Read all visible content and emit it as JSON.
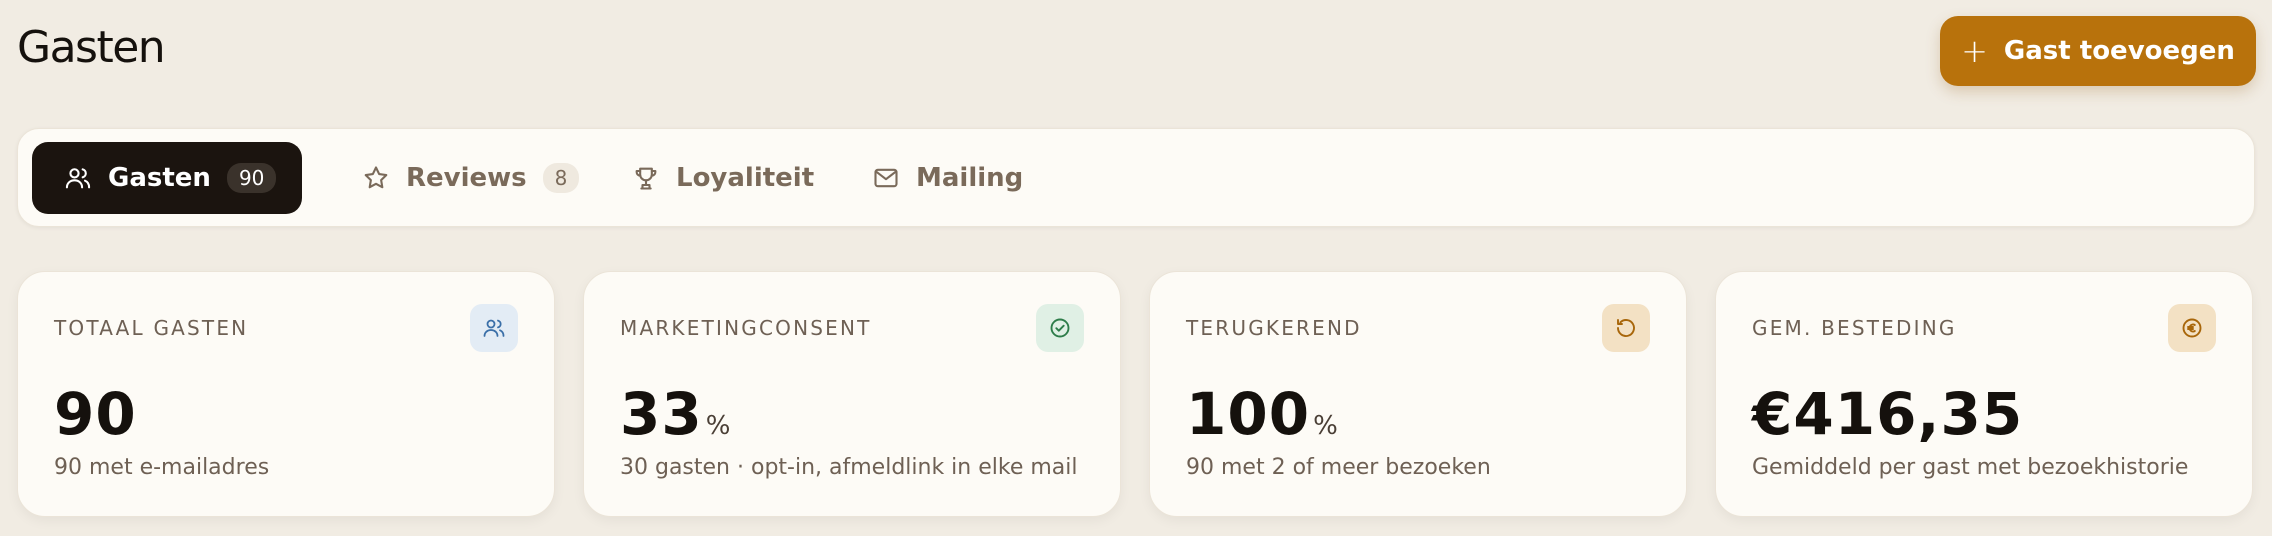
{
  "header": {
    "title": "Gasten",
    "add_button_icon": "plus-icon",
    "add_button_label": "Gast toevoegen"
  },
  "tabs": [
    {
      "label": "Gasten",
      "count": "90",
      "icon": "users-icon",
      "active": true
    },
    {
      "label": "Reviews",
      "count": "8",
      "icon": "star-icon",
      "active": false
    },
    {
      "label": "Loyaliteit",
      "icon": "trophy-icon",
      "active": false
    },
    {
      "label": "Mailing",
      "icon": "mail-icon",
      "active": false
    }
  ],
  "stats": [
    {
      "label": "TOTAAL GASTEN",
      "value": "90",
      "unit": "",
      "sub": "90 met e-mailadres",
      "icon": "users-icon",
      "icon_bg": "#e3ecf5",
      "icon_color": "#3a6fa8"
    },
    {
      "label": "MARKETINGCONSENT",
      "value": "33",
      "unit": "%",
      "sub": "30 gasten · opt-in, afmeldlink in elke mail",
      "icon": "check-circle-icon",
      "icon_bg": "#e0f0e5",
      "icon_color": "#2e7d4a"
    },
    {
      "label": "TERUGKEREND",
      "value": "100",
      "unit": "%",
      "sub": "90 met 2 of meer bezoeken",
      "icon": "rotate-icon",
      "icon_bg": "#f3e1c4",
      "icon_color": "#a8660a"
    },
    {
      "label": "GEM. BESTEDING",
      "value": "€416,35",
      "unit": "",
      "sub": "Gemiddeld per gast met bezoekhistorie",
      "icon": "euro-icon",
      "icon_bg": "#f3e1c4",
      "icon_color": "#a8660a"
    }
  ],
  "colors": {
    "background": "#f1ece3",
    "accent": "#b8720c",
    "tab_active": "#1b140f"
  }
}
